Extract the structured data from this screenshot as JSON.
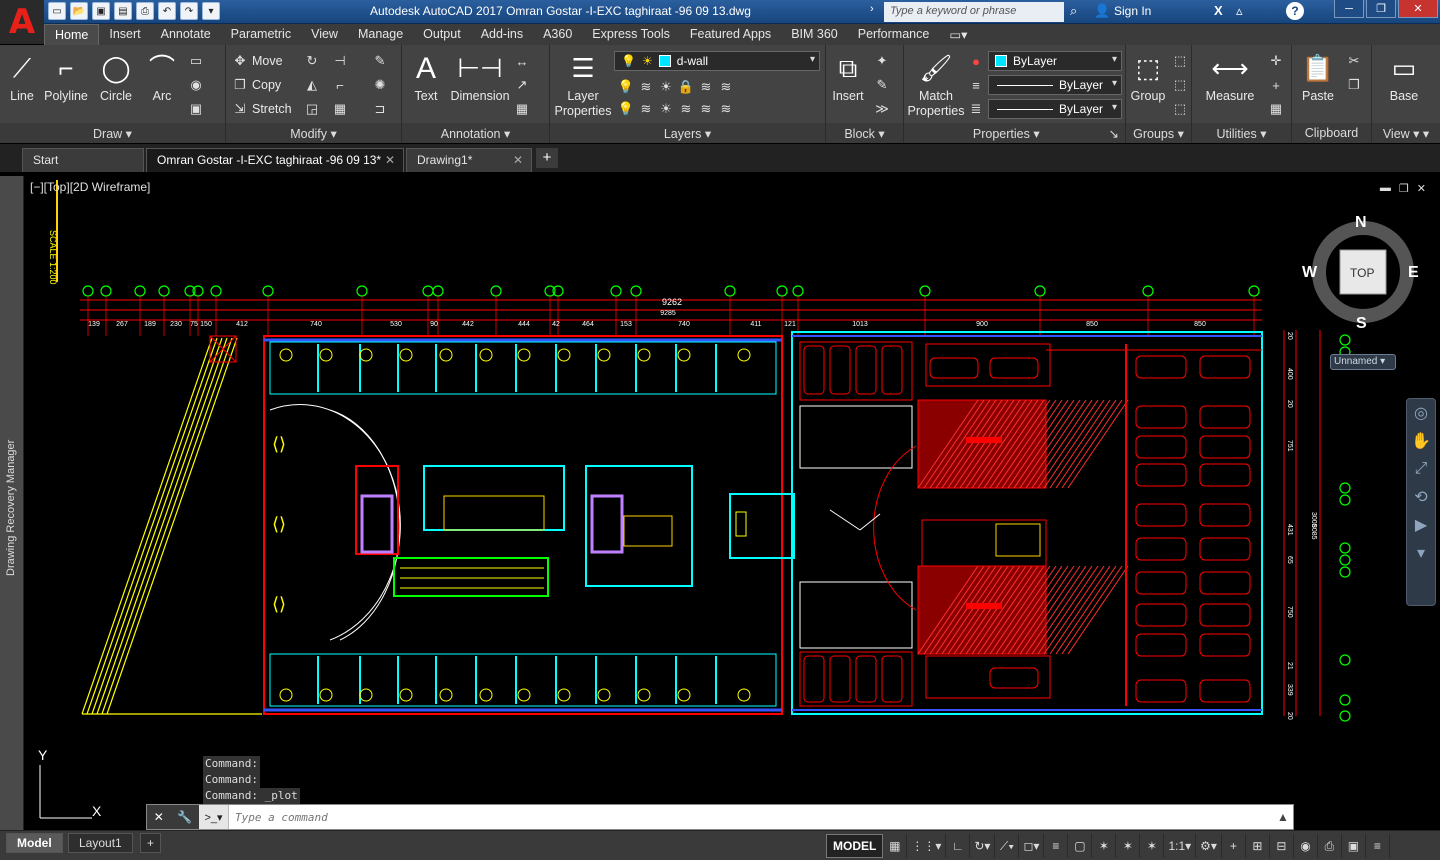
{
  "app": {
    "title": "Autodesk AutoCAD 2017    Omran Gostar -I-EXC   taghiraat -96 09 13.dwg",
    "search_placeholder": "Type a keyword or phrase",
    "sign_in": "Sign In",
    "logo": "A"
  },
  "ribbon_tabs": [
    "Home",
    "Insert",
    "Annotate",
    "Parametric",
    "View",
    "Manage",
    "Output",
    "Add-ins",
    "A360",
    "Express Tools",
    "Featured Apps",
    "BIM 360",
    "Performance"
  ],
  "ribbon": {
    "draw": {
      "title": "Draw",
      "line": "Line",
      "polyline": "Polyline",
      "circle": "Circle",
      "arc": "Arc"
    },
    "modify": {
      "title": "Modify",
      "move": "Move",
      "copy": "Copy",
      "stretch": "Stretch"
    },
    "annotation": {
      "title": "Annotation",
      "text": "Text",
      "dimension": "Dimension"
    },
    "layers": {
      "title": "Layers",
      "layer_properties_1": "Layer",
      "layer_properties_2": "Properties",
      "current_layer": "d-wall"
    },
    "block": {
      "title": "Block",
      "insert": "Insert"
    },
    "properties": {
      "title": "Properties",
      "match_1": "Match",
      "match_2": "Properties",
      "color": "ByLayer",
      "linetype": "ByLayer",
      "lineweight": "ByLayer"
    },
    "groups": {
      "title": "Groups",
      "group": "Group"
    },
    "utilities": {
      "title": "Utilities",
      "measure": "Measure"
    },
    "clipboard": {
      "title": "Clipboard",
      "paste": "Paste"
    },
    "view": {
      "title": "View",
      "base": "Base"
    }
  },
  "doc_tabs": [
    "Start",
    "Omran Gostar -I-EXC   taghiraat -96 09 13*",
    "Drawing1*"
  ],
  "side_panel": "Drawing Recovery Manager",
  "viewport": {
    "label": "[−][Top][2D Wireframe]",
    "cube": {
      "n": "N",
      "s": "S",
      "e": "E",
      "w": "W",
      "face": "TOP",
      "ucs": "Unnamed"
    },
    "scale_text": "SCALE 1:200",
    "dims_total": "9262",
    "dims_inner": "9285",
    "dims_row": [
      "139",
      "267",
      "189",
      "230",
      "75",
      "150",
      "412",
      "740",
      "530",
      "90",
      "442",
      "444",
      "42",
      "464",
      "153",
      "740",
      "411",
      "121",
      "1013",
      "900",
      "850",
      "850"
    ],
    "dims_right": [
      "20",
      "400",
      "20",
      "751",
      "431",
      "65",
      "750",
      "21",
      "339",
      "20"
    ],
    "dims_right_total": [
      "3005",
      "8085"
    ],
    "axis_y": "Y",
    "axis_x": "X"
  },
  "colors": {
    "accent": "#2b5f9e",
    "wall": "#ff0000",
    "cyan": "#00ffff",
    "yellow": "#ffff00",
    "green": "#00ff00",
    "blue": "#3355ff",
    "magenta": "#c080ff"
  },
  "command_history": [
    "Command:",
    "Command:",
    "Command:  _plot"
  ],
  "command_placeholder": "Type a command",
  "layout_tabs": [
    "Model",
    "Layout1"
  ],
  "status": {
    "model": "MODEL",
    "scale": "1:1"
  }
}
